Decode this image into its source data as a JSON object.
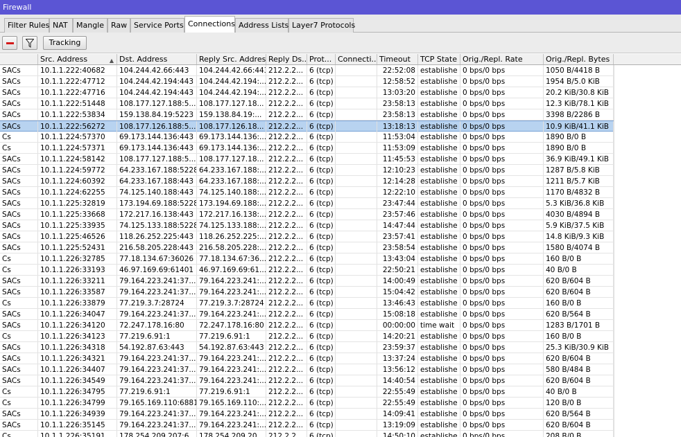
{
  "window": {
    "title": "Firewall"
  },
  "tabs": [
    {
      "label": "Filter Rules"
    },
    {
      "label": "NAT"
    },
    {
      "label": "Mangle"
    },
    {
      "label": "Raw"
    },
    {
      "label": "Service Ports"
    },
    {
      "label": "Connections",
      "active": true
    },
    {
      "label": "Address Lists"
    },
    {
      "label": "Layer7 Protocols"
    }
  ],
  "toolbar": {
    "remove_icon": "minus-icon",
    "filter_icon": "filter-icon",
    "tracking_label": "Tracking"
  },
  "columns": [
    "",
    "Src. Address",
    "Dst. Address",
    "Reply Src. Address",
    "Reply Ds...",
    "Prot...",
    "Connecti...",
    "Timeout",
    "TCP State",
    "Orig./Repl. Rate",
    "Orig./Repl. Bytes"
  ],
  "colors": {
    "title_bg": "#5b55d4",
    "selected_row": "#b8d3f0",
    "remove_icon": "#d41a1a"
  },
  "rows": [
    [
      "SACs",
      "10.1.1.222:40682",
      "104.244.42.66:443",
      "104.244.42.66:443",
      "212.2.2...",
      "6 (tcp)",
      "",
      "22:52:08",
      "establishe",
      "0 bps/0 bps",
      "1050 B/4418 B"
    ],
    [
      "SACs",
      "10.1.1.222:47712",
      "104.244.42.194:443",
      "104.244.42.194:...",
      "212.2.2...",
      "6 (tcp)",
      "",
      "12:58:52",
      "establishe",
      "0 bps/0 bps",
      "1954 B/5.0 KiB"
    ],
    [
      "SACs",
      "10.1.1.222:47716",
      "104.244.42.194:443",
      "104.244.42.194:...",
      "212.2.2...",
      "6 (tcp)",
      "",
      "13:03:20",
      "establishe",
      "0 bps/0 bps",
      "20.2 KiB/30.8 KiB"
    ],
    [
      "SACs",
      "10.1.1.222:51448",
      "108.177.127.188:5...",
      "108.177.127.18...",
      "212.2.2...",
      "6 (tcp)",
      "",
      "23:58:13",
      "establishe",
      "0 bps/0 bps",
      "12.3 KiB/78.1 KiB"
    ],
    [
      "SACs",
      "10.1.1.222:53834",
      "159.138.84.19:5223",
      "159.138.84.19:...",
      "212.2.2...",
      "6 (tcp)",
      "",
      "23:58:13",
      "establishe",
      "0 bps/0 bps",
      "3398 B/2286 B"
    ],
    [
      "SACs",
      "10.1.1.222:56272",
      "108.177.126.188:5...",
      "108.177.126.18...",
      "212.2.2...",
      "6 (tcp)",
      "",
      "13:18:13",
      "establishe",
      "0 bps/0 bps",
      "10.9 KiB/41.1 KiB"
    ],
    [
      "Cs",
      "10.1.1.224:57370",
      "69.173.144.136:443",
      "69.173.144.136:...",
      "212.2.2...",
      "6 (tcp)",
      "",
      "11:53:04",
      "establishe",
      "0 bps/0 bps",
      "1890 B/0 B"
    ],
    [
      "Cs",
      "10.1.1.224:57371",
      "69.173.144.136:443",
      "69.173.144.136:...",
      "212.2.2...",
      "6 (tcp)",
      "",
      "11:53:09",
      "establishe",
      "0 bps/0 bps",
      "1890 B/0 B"
    ],
    [
      "SACs",
      "10.1.1.224:58142",
      "108.177.127.188:5...",
      "108.177.127.18...",
      "212.2.2...",
      "6 (tcp)",
      "",
      "11:45:53",
      "establishe",
      "0 bps/0 bps",
      "36.9 KiB/49.1 KiB"
    ],
    [
      "SACs",
      "10.1.1.224:59772",
      "64.233.167.188:5228",
      "64.233.167.188:...",
      "212.2.2...",
      "6 (tcp)",
      "",
      "12:10:23",
      "establishe",
      "0 bps/0 bps",
      "1287 B/5.8 KiB"
    ],
    [
      "SACs",
      "10.1.1.224:60392",
      "64.233.167.188:443",
      "64.233.167.188:...",
      "212.2.2...",
      "6 (tcp)",
      "",
      "12:14:28",
      "establishe",
      "0 bps/0 bps",
      "1211 B/5.7 KiB"
    ],
    [
      "SACs",
      "10.1.1.224:62255",
      "74.125.140.188:443",
      "74.125.140.188:...",
      "212.2.2...",
      "6 (tcp)",
      "",
      "12:22:10",
      "establishe",
      "0 bps/0 bps",
      "1170 B/4832 B"
    ],
    [
      "SACs",
      "10.1.1.225:32819",
      "173.194.69.188:5228",
      "173.194.69.188:...",
      "212.2.2...",
      "6 (tcp)",
      "",
      "23:47:44",
      "establishe",
      "0 bps/0 bps",
      "5.3 KiB/36.8 KiB"
    ],
    [
      "SACs",
      "10.1.1.225:33668",
      "172.217.16.138:443",
      "172.217.16.138:...",
      "212.2.2...",
      "6 (tcp)",
      "",
      "23:57:46",
      "establishe",
      "0 bps/0 bps",
      "4030 B/4894 B"
    ],
    [
      "SACs",
      "10.1.1.225:33935",
      "74.125.133.188:5228",
      "74.125.133.188:...",
      "212.2.2...",
      "6 (tcp)",
      "",
      "14:47:44",
      "establishe",
      "0 bps/0 bps",
      "5.9 KiB/37.5 KiB"
    ],
    [
      "SACs",
      "10.1.1.225:46526",
      "118.26.252.225:443",
      "118.26.252.225:...",
      "212.2.2...",
      "6 (tcp)",
      "",
      "23:57:41",
      "establishe",
      "0 bps/0 bps",
      "14.8 KiB/9.3 KiB"
    ],
    [
      "SACs",
      "10.1.1.225:52431",
      "216.58.205.228:443",
      "216.58.205.228:...",
      "212.2.2...",
      "6 (tcp)",
      "",
      "23:58:54",
      "establishe",
      "0 bps/0 bps",
      "1580 B/4074 B"
    ],
    [
      "Cs",
      "10.1.1.226:32785",
      "77.18.134.67:36026",
      "77.18.134.67:36...",
      "212.2.2...",
      "6 (tcp)",
      "",
      "13:43:04",
      "establishe",
      "0 bps/0 bps",
      "160 B/0 B"
    ],
    [
      "Cs",
      "10.1.1.226:33193",
      "46.97.169.69:61401",
      "46.97.169.69:61...",
      "212.2.2...",
      "6 (tcp)",
      "",
      "22:50:21",
      "establishe",
      "0 bps/0 bps",
      "40 B/0 B"
    ],
    [
      "SACs",
      "10.1.1.226:33211",
      "79.164.223.241:37...",
      "79.164.223.241:...",
      "212.2.2...",
      "6 (tcp)",
      "",
      "14:00:49",
      "establishe",
      "0 bps/0 bps",
      "620 B/604 B"
    ],
    [
      "SACs",
      "10.1.1.226:33587",
      "79.164.223.241:37...",
      "79.164.223.241:...",
      "212.2.2...",
      "6 (tcp)",
      "",
      "15:04:42",
      "establishe",
      "0 bps/0 bps",
      "620 B/604 B"
    ],
    [
      "Cs",
      "10.1.1.226:33879",
      "77.219.3.7:28724",
      "77.219.3.7:28724",
      "212.2.2...",
      "6 (tcp)",
      "",
      "13:46:43",
      "establishe",
      "0 bps/0 bps",
      "160 B/0 B"
    ],
    [
      "SACs",
      "10.1.1.226:34047",
      "79.164.223.241:37...",
      "79.164.223.241:...",
      "212.2.2...",
      "6 (tcp)",
      "",
      "15:08:18",
      "establishe",
      "0 bps/0 bps",
      "620 B/564 B"
    ],
    [
      "SACs",
      "10.1.1.226:34120",
      "72.247.178.16:80",
      "72.247.178.16:80",
      "212.2.2...",
      "6 (tcp)",
      "",
      "00:00:00",
      "time wait",
      "0 bps/0 bps",
      "1283 B/1701 B"
    ],
    [
      "Cs",
      "10.1.1.226:34123",
      "77.219.6.91:1",
      "77.219.6.91:1",
      "212.2.2...",
      "6 (tcp)",
      "",
      "14:20:21",
      "establishe",
      "0 bps/0 bps",
      "160 B/0 B"
    ],
    [
      "SACs",
      "10.1.1.226:34318",
      "54.192.87.63:443",
      "54.192.87.63:443",
      "212.2.2...",
      "6 (tcp)",
      "",
      "23:59:37",
      "establishe",
      "0 bps/0 bps",
      "25.3 KiB/30.9 KiB"
    ],
    [
      "SACs",
      "10.1.1.226:34321",
      "79.164.223.241:37...",
      "79.164.223.241:...",
      "212.2.2...",
      "6 (tcp)",
      "",
      "13:37:24",
      "establishe",
      "0 bps/0 bps",
      "620 B/604 B"
    ],
    [
      "SACs",
      "10.1.1.226:34407",
      "79.164.223.241:37...",
      "79.164.223.241:...",
      "212.2.2...",
      "6 (tcp)",
      "",
      "13:56:12",
      "establishe",
      "0 bps/0 bps",
      "580 B/484 B"
    ],
    [
      "SACs",
      "10.1.1.226:34549",
      "79.164.223.241:37...",
      "79.164.223.241:...",
      "212.2.2...",
      "6 (tcp)",
      "",
      "14:40:54",
      "establishe",
      "0 bps/0 bps",
      "620 B/604 B"
    ],
    [
      "Cs",
      "10.1.1.226:34795",
      "77.219.6.91:1",
      "77.219.6.91:1",
      "212.2.2...",
      "6 (tcp)",
      "",
      "22:55:49",
      "establishe",
      "0 bps/0 bps",
      "40 B/0 B"
    ],
    [
      "Cs",
      "10.1.1.226:34799",
      "79.165.169.110:6881",
      "79.165.169.110:...",
      "212.2.2...",
      "6 (tcp)",
      "",
      "22:55:49",
      "establishe",
      "0 bps/0 bps",
      "120 B/0 B"
    ],
    [
      "SACs",
      "10.1.1.226:34939",
      "79.164.223.241:37...",
      "79.164.223.241:...",
      "212.2.2...",
      "6 (tcp)",
      "",
      "14:09:41",
      "establishe",
      "0 bps/0 bps",
      "620 B/564 B"
    ],
    [
      "SACs",
      "10.1.1.226:35145",
      "79.164.223.241:37...",
      "79.164.223.241:...",
      "212.2.2...",
      "6 (tcp)",
      "",
      "13:19:09",
      "establishe",
      "0 bps/0 bps",
      "620 B/604 B"
    ],
    [
      "Cs",
      "10.1.1.226:35191",
      "178.254.209.207:6...",
      "178.254.209.20...",
      "212.2.2...",
      "6 (tcp)",
      "",
      "14:50:10",
      "establishe",
      "0 bps/0 bps",
      "208 B/0 B"
    ]
  ],
  "selected_row": 5
}
